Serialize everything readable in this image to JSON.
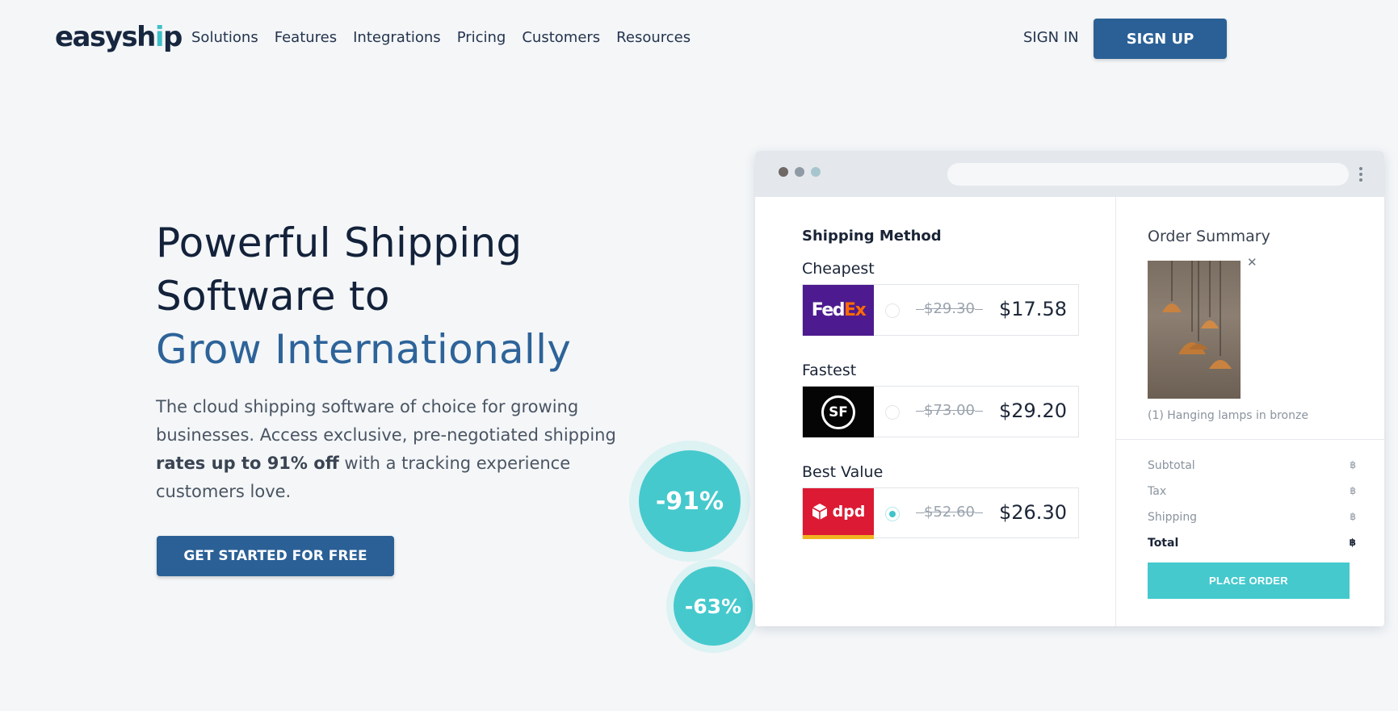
{
  "nav": {
    "logo_main": "easysh",
    "logo_accent": "i",
    "logo_end": "p",
    "links": [
      "Solutions",
      "Features",
      "Integrations",
      "Pricing",
      "Customers",
      "Resources"
    ],
    "sign_in": "SIGN IN",
    "sign_up": "SIGN UP"
  },
  "hero": {
    "title_line1": "Powerful Shipping",
    "title_line2": "Software to",
    "title_highlight": "Grow Internationally",
    "sub_part1": "The cloud shipping software of choice for growing businesses. Access exclusive, pre-negotiated shipping ",
    "sub_bold": "rates up to 91% off",
    "sub_part2": " with a tracking experience customers love.",
    "cta": "GET STARTED FOR FREE"
  },
  "badges": {
    "big": "-91%",
    "small": "-63%"
  },
  "mockup": {
    "shipping_title": "Shipping Method",
    "rates": [
      {
        "label": "Cheapest",
        "carrier": "FedEx",
        "old_price": "$29.30",
        "new_price": "$17.58",
        "selected": false
      },
      {
        "label": "Fastest",
        "carrier": "SF",
        "old_price": "$73.00",
        "new_price": "$29.20",
        "selected": false
      },
      {
        "label": "Best Value",
        "carrier": "dpd",
        "old_price": "$52.60",
        "new_price": "$26.30",
        "selected": true
      }
    ],
    "order_title": "Order Summary",
    "product_caption": "(1) Hanging lamps in bronze",
    "summary": {
      "subtotal": "Subtotal",
      "tax": "Tax",
      "shipping": "Shipping",
      "total": "Total",
      "currency_symbol": "฿"
    },
    "place_order": "PLACE ORDER"
  },
  "colors": {
    "primary": "#2a6096",
    "teal": "#45c9cd",
    "background": "#f4f6f8"
  }
}
